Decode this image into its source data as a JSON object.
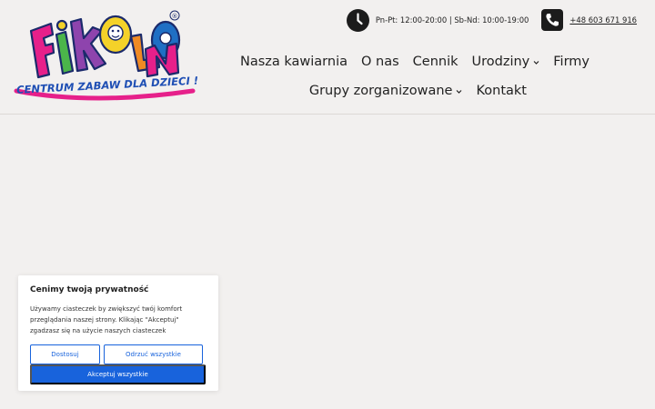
{
  "brand": {
    "logo_letters": "FIKOLNO",
    "logo_tagline": "CENTRUM ZABAW DLA DZIECI !",
    "registered_mark": "®",
    "colors": {
      "pink": "#e6208a",
      "blue": "#1f6fc4",
      "yellow": "#f4d229",
      "green": "#4bb54a",
      "purple": "#8e44ad",
      "orange": "#f08a24"
    }
  },
  "topbar": {
    "hours_icon": "clock-icon",
    "hours": "Pn-Pt: 12:00-20:00 | Sb-Nd: 10:00-19:00",
    "phone_icon": "phone-icon",
    "phone": "+48 603 671 916"
  },
  "nav": {
    "items": [
      {
        "label": "Nasza kawiarnia",
        "dropdown": false
      },
      {
        "label": "O nas",
        "dropdown": false
      },
      {
        "label": "Cennik",
        "dropdown": false
      },
      {
        "label": "Urodziny",
        "dropdown": true
      },
      {
        "label": "Firmy",
        "dropdown": false
      },
      {
        "label": "Grupy zorganizowane",
        "dropdown": true
      },
      {
        "label": "Kontakt",
        "dropdown": false
      }
    ]
  },
  "cookie_banner": {
    "title": "Cenimy twoją prywatność",
    "text": "Używamy ciasteczek by zwiększyć twój komfort przeglądania naszej strony. Klikając \"Akceptuj\" zgadzasz się na użycie naszych ciasteczek",
    "customize_label": "Dostosuj",
    "reject_label": "Odrzuć wszystkie",
    "accept_label": "Akceptuj wszystkie",
    "accent_color": "#1863dc"
  }
}
